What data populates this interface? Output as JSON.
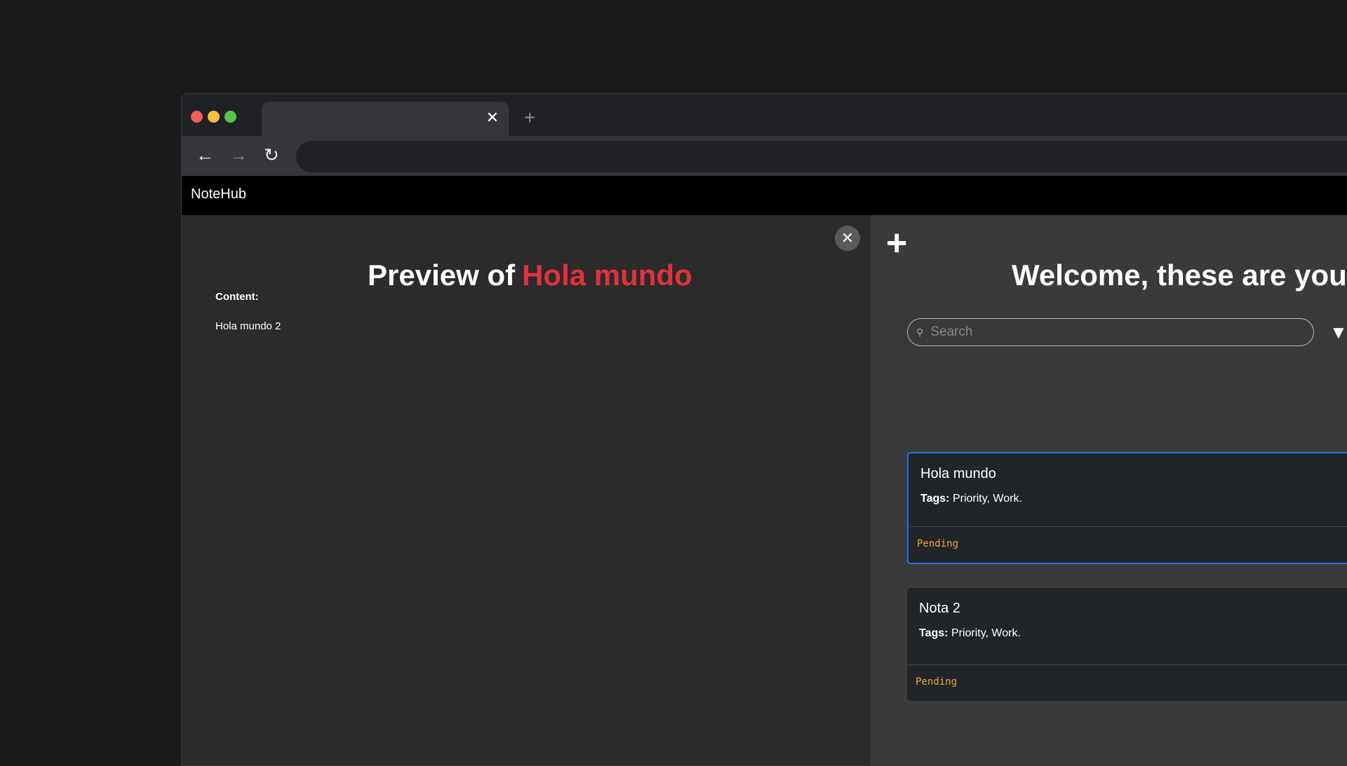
{
  "browser": {
    "tab_close": "✕",
    "new_tab": "+",
    "back": "←",
    "forward": "→",
    "reload": "↻"
  },
  "app": {
    "brand": "NoteHub"
  },
  "preview": {
    "close": "✕",
    "title_prefix": "Preview of",
    "title_note": "Hola mundo",
    "content_label": "Content:",
    "content": "Hola mundo 2"
  },
  "notes": {
    "add": "+",
    "welcome": "Welcome, these are your notes",
    "search_placeholder": "Search",
    "items": [
      {
        "title": "Hola mundo",
        "tags_label": "Tags:",
        "tags": "Priority, Work.",
        "status": "Pending"
      },
      {
        "title": "Nota 2",
        "tags_label": "Tags:",
        "tags": "Priority, Work.",
        "status": "Pending"
      }
    ]
  },
  "colors": {
    "accent": "#e0323f",
    "selected": "#1e74e6",
    "pending": "#f2a33a"
  }
}
